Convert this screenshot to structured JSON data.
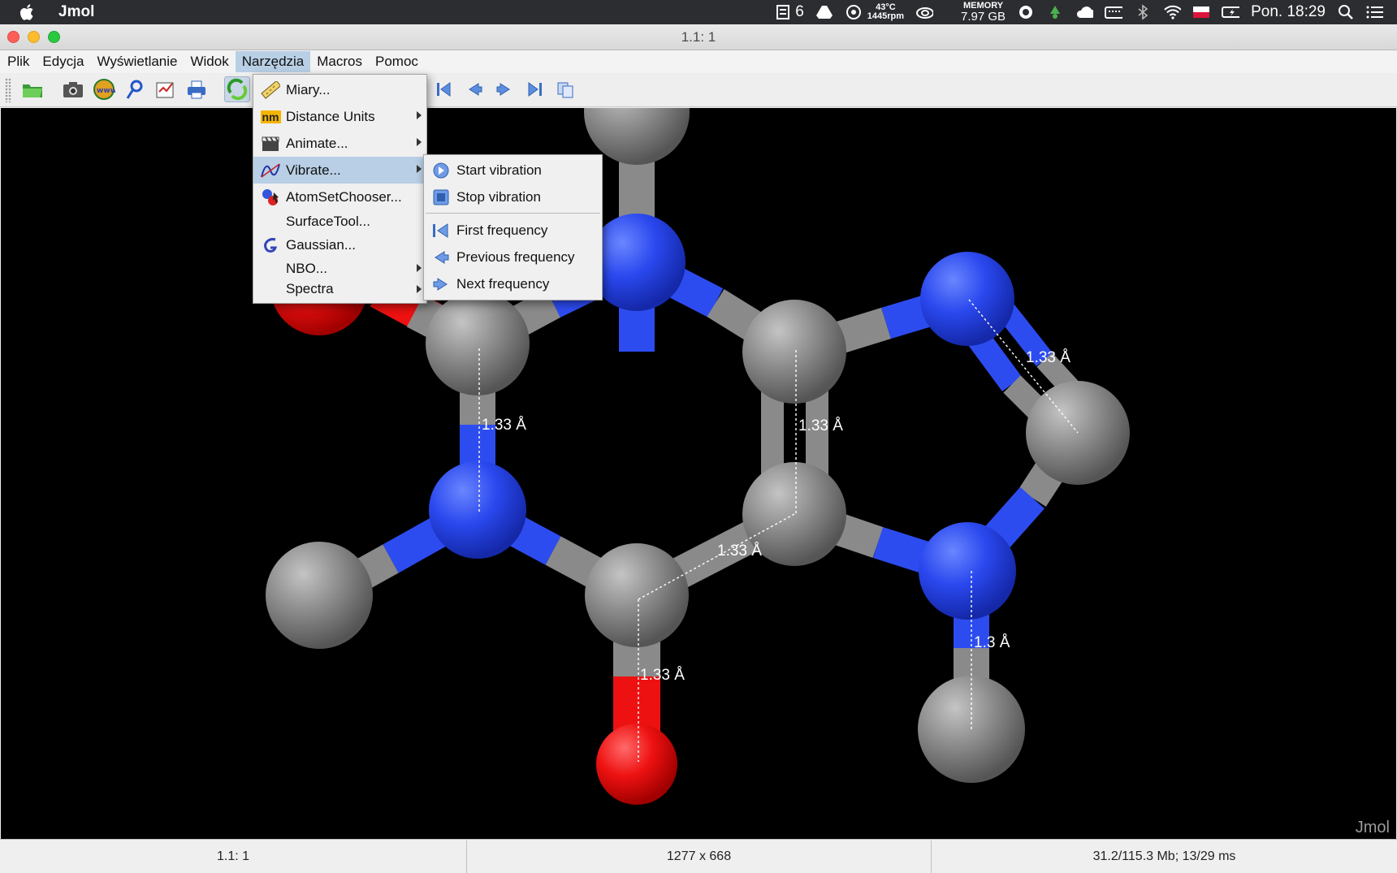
{
  "system_menubar": {
    "app_name": "Jmol",
    "badge_count": "6",
    "temp": "43°C",
    "fan": "1445rpm",
    "memory_label": "MEMORY",
    "memory_value": "7.97 GB",
    "clock": "Pon. 18:29"
  },
  "window": {
    "title": "1.1: 1"
  },
  "menubar": {
    "items": [
      {
        "label": "Plik"
      },
      {
        "label": "Edycja"
      },
      {
        "label": "Wyświetlanie"
      },
      {
        "label": "Widok"
      },
      {
        "label": "Narzędzia"
      },
      {
        "label": "Macros"
      },
      {
        "label": "Pomoc"
      }
    ]
  },
  "tools_menu": {
    "items": [
      {
        "label": "Miary...",
        "icon": "ruler-icon"
      },
      {
        "label": "Distance Units",
        "icon": "nm-icon",
        "icon_text": "nm",
        "submenu": true
      },
      {
        "label": "Animate...",
        "icon": "clapper-icon",
        "submenu": true
      },
      {
        "label": "Vibrate...",
        "icon": "vibrate-icon",
        "submenu": true
      },
      {
        "label": "AtomSetChooser...",
        "icon": "atoms-icon"
      },
      {
        "label": "SurfaceTool..."
      },
      {
        "label": "Gaussian...",
        "icon": "gaussian-icon"
      },
      {
        "label": "NBO...",
        "submenu": true
      },
      {
        "label": "Spectra",
        "submenu": true
      }
    ]
  },
  "vibrate_submenu": {
    "items": [
      {
        "label": "Start vibration"
      },
      {
        "label": "Stop vibration"
      },
      {
        "label": "First frequency"
      },
      {
        "label": "Previous frequency"
      },
      {
        "label": "Next frequency"
      }
    ]
  },
  "viewer": {
    "watermark": "Jmol",
    "measurements": [
      "1.33 Å",
      "1.33 Å",
      "1.33 Å",
      "1.33 Å",
      "1.33 Å",
      "1.3 Å"
    ]
  },
  "statusbar": {
    "frame": "1.1: 1",
    "size": "1277 x 668",
    "memory": "31.2/115.3 Mb;   13/29 ms"
  },
  "colors": {
    "carbon": "#8a8a8a",
    "nitrogen": "#2d4cf0",
    "oxygen": "#ee1111",
    "menu_highlight": "#b8cfe5"
  }
}
